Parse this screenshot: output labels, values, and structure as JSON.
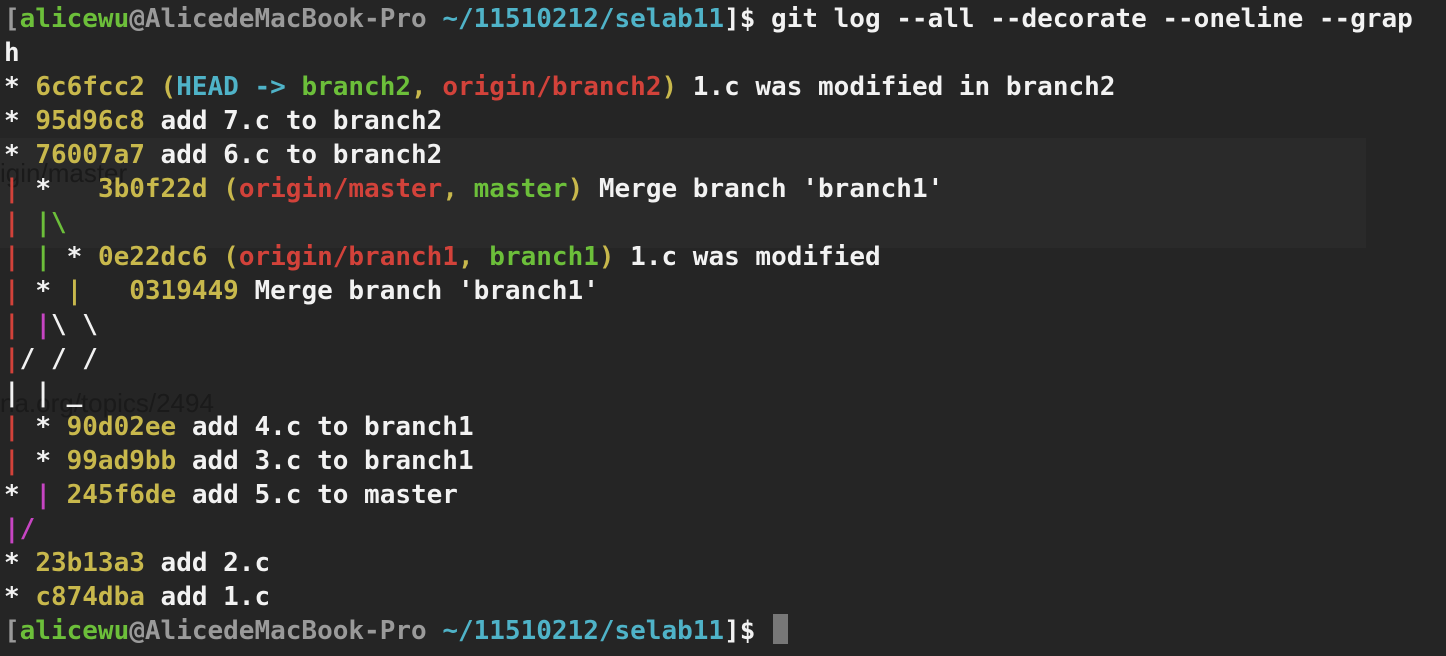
{
  "colors": {
    "white": "#f2f2f2",
    "gray": "#9a9a9a",
    "green": "#6cbf3a",
    "cyan": "#4fb3c8",
    "yellow": "#c8b84c",
    "red": "#d2423a",
    "magenta": "#c745c3",
    "cursor": "#777777",
    "background": "#252525"
  },
  "background_fragments": {
    "fragment_1": "igin/master",
    "fragment_2": "na.org/topics/2494"
  },
  "lines": [
    [
      {
        "t": "[",
        "c": "gray"
      },
      {
        "t": "alicewu",
        "c": "green"
      },
      {
        "t": "@AlicedeMacBook-Pro ",
        "c": "gray"
      },
      {
        "t": "~/11510212/selab11",
        "c": "cyan"
      },
      {
        "t": "]$ git log --all --decorate --oneline --grap",
        "c": "white"
      }
    ],
    [
      {
        "t": "h",
        "c": "white"
      }
    ],
    [
      {
        "t": "* ",
        "c": "white"
      },
      {
        "t": "6c6fcc2 ",
        "c": "yellow"
      },
      {
        "t": "(",
        "c": "yellow"
      },
      {
        "t": "HEAD -> ",
        "c": "cyan"
      },
      {
        "t": "branch2",
        "c": "green"
      },
      {
        "t": ", ",
        "c": "yellow"
      },
      {
        "t": "origin/branch2",
        "c": "red"
      },
      {
        "t": ")",
        "c": "yellow"
      },
      {
        "t": " 1.c was modified in branch2",
        "c": "white"
      }
    ],
    [
      {
        "t": "* ",
        "c": "white"
      },
      {
        "t": "95d96c8",
        "c": "yellow"
      },
      {
        "t": " add 7.c to branch2",
        "c": "white"
      }
    ],
    [
      {
        "t": "* ",
        "c": "white"
      },
      {
        "t": "76007a7",
        "c": "yellow"
      },
      {
        "t": " add 6.c to branch2",
        "c": "white"
      }
    ],
    [
      {
        "t": "| ",
        "c": "red"
      },
      {
        "t": "*   ",
        "c": "white"
      },
      {
        "t": "3b0f22d ",
        "c": "yellow"
      },
      {
        "t": "(",
        "c": "yellow"
      },
      {
        "t": "origin/master",
        "c": "red"
      },
      {
        "t": ", ",
        "c": "yellow"
      },
      {
        "t": "master",
        "c": "green"
      },
      {
        "t": ")",
        "c": "yellow"
      },
      {
        "t": " Merge branch 'branch1'",
        "c": "white"
      }
    ],
    [
      {
        "t": "| ",
        "c": "red"
      },
      {
        "t": "|\\",
        "c": "green"
      }
    ],
    [
      {
        "t": "| ",
        "c": "red"
      },
      {
        "t": "| ",
        "c": "green"
      },
      {
        "t": "* ",
        "c": "white"
      },
      {
        "t": "0e22dc6 ",
        "c": "yellow"
      },
      {
        "t": "(",
        "c": "yellow"
      },
      {
        "t": "origin/branch1",
        "c": "red"
      },
      {
        "t": ", ",
        "c": "yellow"
      },
      {
        "t": "branch1",
        "c": "green"
      },
      {
        "t": ")",
        "c": "yellow"
      },
      {
        "t": " 1.c was modified",
        "c": "white"
      }
    ],
    [
      {
        "t": "| ",
        "c": "red"
      },
      {
        "t": "* ",
        "c": "white"
      },
      {
        "t": "|   ",
        "c": "yellow"
      },
      {
        "t": "0319449",
        "c": "yellow"
      },
      {
        "t": " Merge branch 'branch1'",
        "c": "white"
      }
    ],
    [
      {
        "t": "| ",
        "c": "red"
      },
      {
        "t": "|",
        "c": "magenta"
      },
      {
        "t": "\\ \\",
        "c": "white"
      }
    ],
    [
      {
        "t": "|",
        "c": "red"
      },
      {
        "t": "/ / /",
        "c": "white"
      }
    ],
    [
      {
        "t": "| | _",
        "c": "white"
      }
    ],
    [
      {
        "t": "| ",
        "c": "red"
      },
      {
        "t": "* ",
        "c": "white"
      },
      {
        "t": "90d02ee",
        "c": "yellow"
      },
      {
        "t": " add 4.c to branch1",
        "c": "white"
      }
    ],
    [
      {
        "t": "| ",
        "c": "red"
      },
      {
        "t": "* ",
        "c": "white"
      },
      {
        "t": "99ad9bb",
        "c": "yellow"
      },
      {
        "t": " add 3.c to branch1",
        "c": "white"
      }
    ],
    [
      {
        "t": "* ",
        "c": "white"
      },
      {
        "t": "| ",
        "c": "magenta"
      },
      {
        "t": "245f6de",
        "c": "yellow"
      },
      {
        "t": " add 5.c to master",
        "c": "white"
      }
    ],
    [
      {
        "t": "|/",
        "c": "magenta"
      }
    ],
    [
      {
        "t": "* ",
        "c": "white"
      },
      {
        "t": "23b13a3",
        "c": "yellow"
      },
      {
        "t": " add 2.c",
        "c": "white"
      }
    ],
    [
      {
        "t": "* ",
        "c": "white"
      },
      {
        "t": "c874dba",
        "c": "yellow"
      },
      {
        "t": " add 1.c",
        "c": "white"
      }
    ],
    [
      {
        "t": "[",
        "c": "gray"
      },
      {
        "t": "alicewu",
        "c": "green"
      },
      {
        "t": "@AlicedeMacBook-Pro ",
        "c": "gray"
      },
      {
        "t": "~/11510212/selab11",
        "c": "cyan"
      },
      {
        "t": "]$ ",
        "c": "white"
      }
    ]
  ]
}
